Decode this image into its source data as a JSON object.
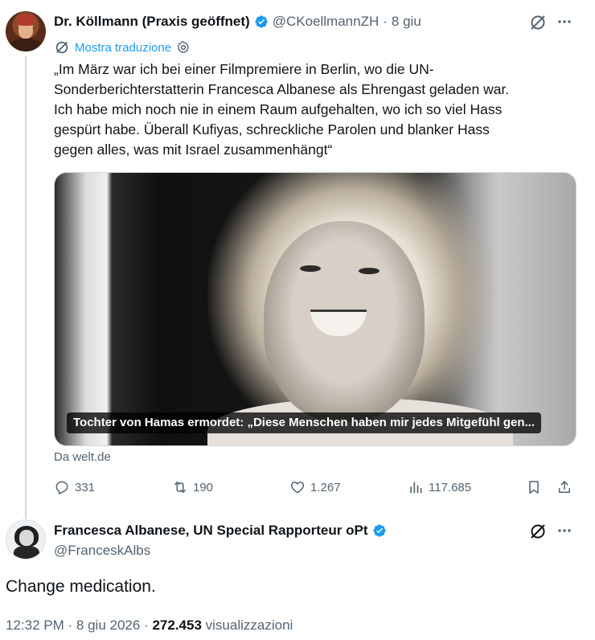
{
  "tweet": {
    "author_name": "Dr. Köllmann (Praxis geöffnet)",
    "handle": "@CKoellmannZH",
    "separator": "·",
    "date": "8 giu",
    "translate_label": "Mostra traduzione",
    "text_lines": [
      "„Im März war ich bei einer Filmpremiere in Berlin, wo die UN-",
      "Sonderberichterstatterin Francesca Albanese als Ehrengast geladen war.",
      "Ich habe mich noch nie in einem Raum aufgehalten, wo ich so viel Hass",
      "gespürt habe. Überall Kufiyas, schreckliche Parolen und blanker Hass",
      "gegen alles, was mit Israel zusammenhängt“"
    ],
    "card_caption": "Tochter von Hamas ermordet: „Diese Menschen haben mir jedes Mitgefühl gen...",
    "source": "Da welt.de",
    "replies": "331",
    "reposts": "190",
    "likes": "1.267",
    "views": "117.685"
  },
  "reply": {
    "author_name": "Francesca Albanese, UN Special Rapporteur oPt",
    "handle": "@FranceskAlbs",
    "text": "Change medication.",
    "time": "12:32 PM",
    "separator": "·",
    "date": "8 giu 2026",
    "separator2": "·",
    "views_count": "272.453",
    "views_label": "visualizzazioni"
  },
  "colors": {
    "accent": "#1d9bf0",
    "secondary_text": "#536471",
    "primary_text": "#0f1419"
  },
  "icons": {
    "verified": "verified-badge-icon",
    "grok": "grok-icon",
    "more": "more-icon",
    "reply": "reply-icon",
    "repost": "repost-icon",
    "like": "heart-icon",
    "views": "views-icon",
    "bookmark": "bookmark-icon",
    "share": "share-icon",
    "settings": "gear-icon"
  }
}
